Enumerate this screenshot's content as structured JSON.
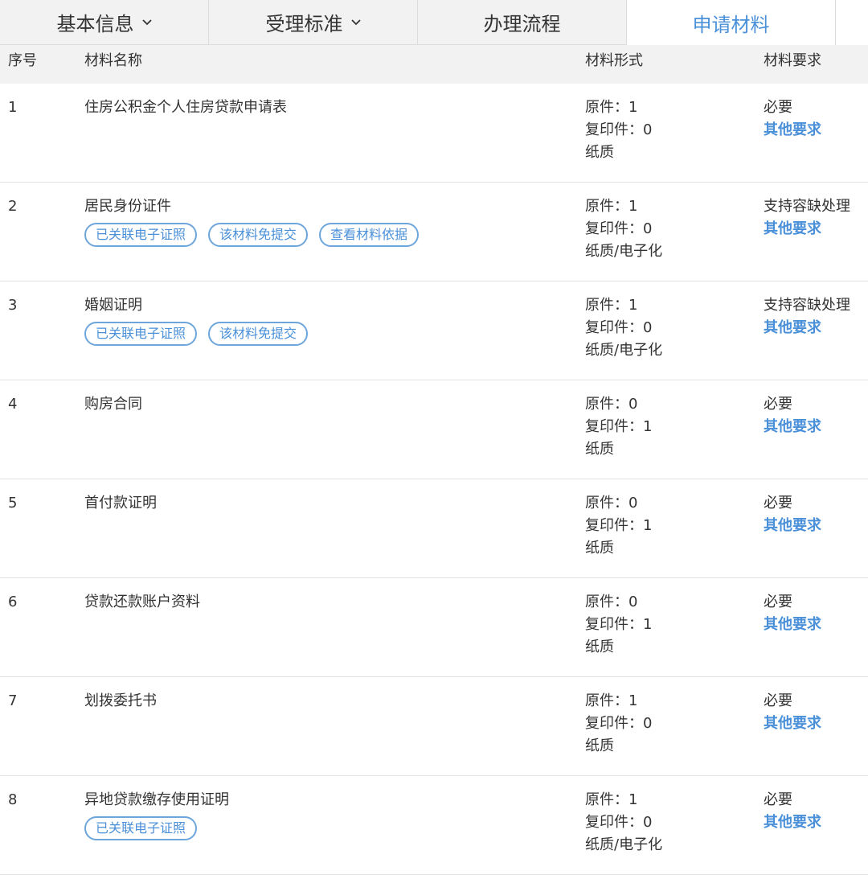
{
  "tabs": [
    {
      "label": "基本信息",
      "has_dropdown": true
    },
    {
      "label": "受理标准",
      "has_dropdown": true
    },
    {
      "label": "办理流程",
      "has_dropdown": false
    },
    {
      "label": "申请材料",
      "has_dropdown": false,
      "active": true
    }
  ],
  "table": {
    "headers": {
      "no": "序号",
      "name": "材料名称",
      "form": "材料形式",
      "req": "材料要求"
    },
    "rows": [
      {
        "no": "1",
        "name": "住房公积金个人住房贷款申请表",
        "badges": [],
        "original": "原件：1",
        "copy": "复印件：0",
        "medium": "纸质",
        "req": "必要",
        "other": "其他要求"
      },
      {
        "no": "2",
        "name": "居民身份证件",
        "badges": [
          "已关联电子证照",
          "该材料免提交",
          "查看材料依据"
        ],
        "original": "原件：1",
        "copy": "复印件：0",
        "medium": "纸质/电子化",
        "req": "支持容缺处理",
        "other": "其他要求"
      },
      {
        "no": "3",
        "name": "婚姻证明",
        "badges": [
          "已关联电子证照",
          "该材料免提交"
        ],
        "original": "原件：1",
        "copy": "复印件：0",
        "medium": "纸质/电子化",
        "req": "支持容缺处理",
        "other": "其他要求"
      },
      {
        "no": "4",
        "name": "购房合同",
        "badges": [],
        "original": "原件：0",
        "copy": "复印件：1",
        "medium": "纸质",
        "req": "必要",
        "other": "其他要求"
      },
      {
        "no": "5",
        "name": "首付款证明",
        "badges": [],
        "original": "原件：0",
        "copy": "复印件：1",
        "medium": "纸质",
        "req": "必要",
        "other": "其他要求"
      },
      {
        "no": "6",
        "name": "贷款还款账户资料",
        "badges": [],
        "original": "原件：0",
        "copy": "复印件：1",
        "medium": "纸质",
        "req": "必要",
        "other": "其他要求"
      },
      {
        "no": "7",
        "name": "划拨委托书",
        "badges": [],
        "original": "原件：1",
        "copy": "复印件：0",
        "medium": "纸质",
        "req": "必要",
        "other": "其他要求"
      },
      {
        "no": "8",
        "name": "异地贷款缴存使用证明",
        "badges": [
          "已关联电子证照"
        ],
        "original": "原件：1",
        "copy": "复印件：0",
        "medium": "纸质/电子化",
        "req": "必要",
        "other": "其他要求"
      }
    ]
  },
  "colors": {
    "accent": "#4a90d9",
    "badge_border": "#6ea6dc",
    "header_bg": "#f2f2f2"
  }
}
